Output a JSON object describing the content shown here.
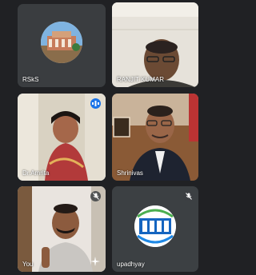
{
  "participants": [
    {
      "name": "RSkS",
      "muted": false
    },
    {
      "name": "RANJIT KUMAR",
      "muted": false
    },
    {
      "name": "Dr.Amrita",
      "muted": false,
      "speaking": true
    },
    {
      "name": "Shrinivas",
      "muted": false
    },
    {
      "name": "You",
      "muted": true
    },
    {
      "name": "upadhyay",
      "muted": true
    }
  ],
  "colors": {
    "background": "#202124",
    "tile": "#3c4043",
    "active_border": "#8ab4f8",
    "speaking_badge": "#1a73e8"
  },
  "icons": [
    "mic-off-icon",
    "speaking-indicator-icon",
    "sparkle-effects-icon"
  ]
}
